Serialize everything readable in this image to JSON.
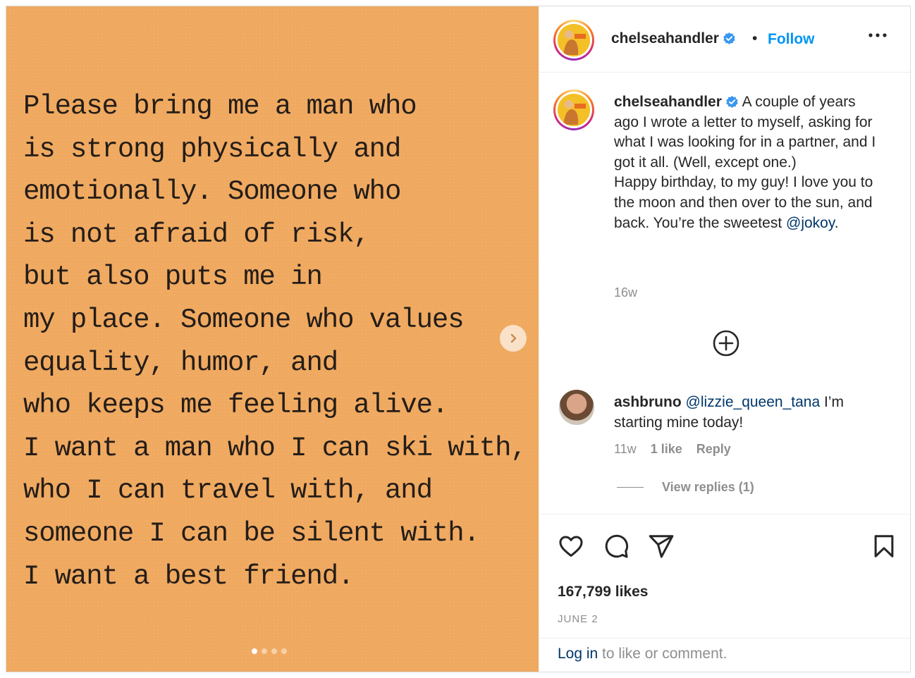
{
  "post": {
    "image_text_lines": [
      "Please bring me a man who",
      "is strong physically and",
      "emotionally. Someone who",
      "is not afraid of risk,",
      "but also puts me in",
      "my place. Someone who values",
      "equality, humor, and",
      "who keeps me feeling alive.",
      "I want a man who I can ski with,",
      "who I can travel with, and",
      "someone I can be silent with.",
      "I want a best friend."
    ],
    "carousel": {
      "total": 4,
      "active": 1
    }
  },
  "header": {
    "username": "chelseahandler",
    "separator": "•",
    "follow_label": "Follow"
  },
  "caption": {
    "username": "chelseahandler",
    "text": " A couple of years ago I wrote a letter to myself, asking for what I was looking for in a partner, and I got it all. (Well, except one.)",
    "text2": "Happy birthday, to my guy! I love you to the moon and then over to the sun, and back. You’re the sweetest ",
    "mention": "@jokoy",
    "end": ".",
    "time": "16w"
  },
  "comment": {
    "username": "ashbruno",
    "mention": "@lizzie_queen_tana",
    "text": " I’m starting mine today!",
    "time": "11w",
    "likes": "1 like",
    "reply_label": "Reply",
    "view_replies": "View replies (1)"
  },
  "footer": {
    "likes": "167,799 likes",
    "date": "JUNE 2",
    "login_link": "Log in",
    "login_rest": " to like or comment."
  },
  "colors": {
    "accent": "#0095f6",
    "link": "#00376b",
    "muted": "#8e8e8e",
    "photo_bg": "#f0a95f"
  },
  "icons": [
    "chevron-right-icon",
    "verified-badge-icon",
    "more-options-icon",
    "add-circle-icon",
    "heart-icon",
    "comment-icon",
    "share-icon",
    "bookmark-icon"
  ]
}
